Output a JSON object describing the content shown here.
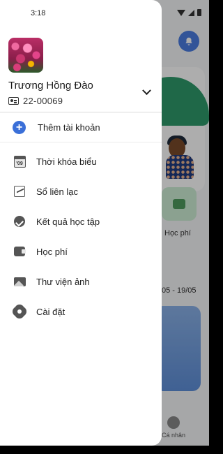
{
  "status_bar": {
    "time": "3:18"
  },
  "user": {
    "name": "Trương Hồng Đào",
    "student_id": "22-00069"
  },
  "drawer": {
    "add_account_label": "Thêm tài khoản",
    "menu": [
      {
        "label": "Thời khóa biểu",
        "icon": "calendar-icon"
      },
      {
        "label": "Sổ liên lạc",
        "icon": "contact-book-icon"
      },
      {
        "label": "Kết quả học tập",
        "icon": "academic-result-icon"
      },
      {
        "label": "Học phí",
        "icon": "wallet-icon"
      },
      {
        "label": "Thư viện ảnh",
        "icon": "image-icon"
      },
      {
        "label": "Cài đặt",
        "icon": "gear-icon"
      }
    ],
    "calendar_badge": "'09"
  },
  "background": {
    "tile_label": "Học phí",
    "date_range": "05 - 19/05",
    "tab_label": "Cá nhân"
  },
  "colors": {
    "accent_blue": "#3a6fd8",
    "drawer_bg": "#ffffff"
  }
}
